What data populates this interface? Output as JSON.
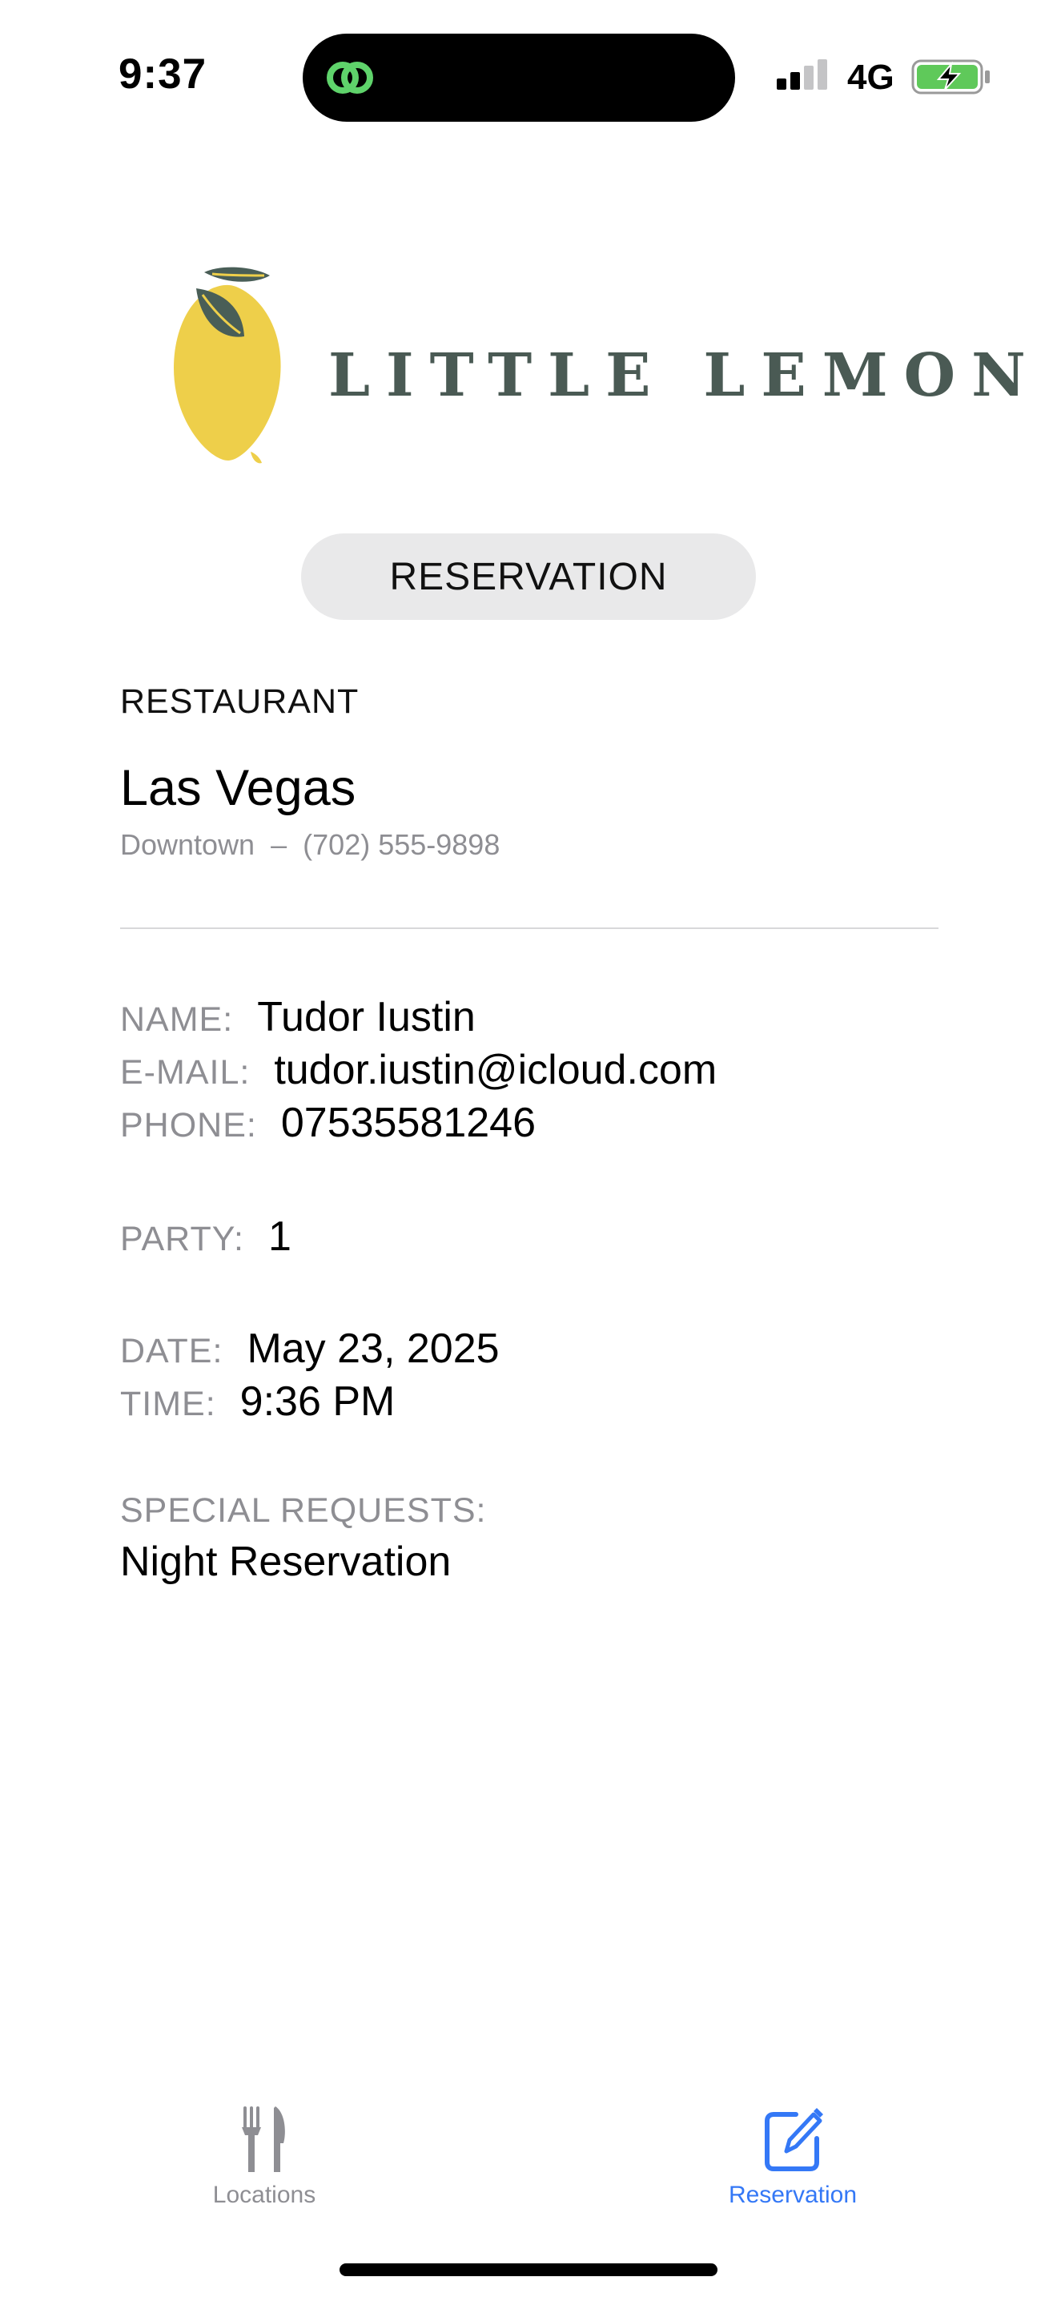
{
  "status_bar": {
    "time": "9:37",
    "network": "4G"
  },
  "logo": {
    "brand": "LITTLE LEMON"
  },
  "header": {
    "title": "RESERVATION"
  },
  "restaurant": {
    "section_label": "RESTAURANT",
    "city": "Las Vegas",
    "neighborhood": "Downtown",
    "separator": "–",
    "phone": "(702) 555-9898"
  },
  "reservation": {
    "name_label": "NAME:",
    "name": "Tudor Iustin",
    "email_label": "E-MAIL:",
    "email": "tudor.iustin@icloud.com",
    "phone_label": "PHONE:",
    "phone": "07535581246",
    "party_label": "PARTY:",
    "party": "1",
    "date_label": "DATE:",
    "date": "May 23, 2025",
    "time_label": "TIME:",
    "time": "9:36 PM",
    "special_label": "SPECIAL REQUESTS:",
    "special": "Night Reservation"
  },
  "tab_bar": {
    "tabs": [
      {
        "label": "Locations",
        "icon": "fork-knife-icon",
        "selected": false
      },
      {
        "label": "Reservation",
        "icon": "square-pencil-icon",
        "selected": true
      }
    ]
  },
  "colors": {
    "accent": "#3478f6",
    "secondary_text": "#8e8e93",
    "brand_text": "#4a5a54",
    "lemon_yellow": "#eecf4a",
    "leaf_green": "#495e57"
  }
}
